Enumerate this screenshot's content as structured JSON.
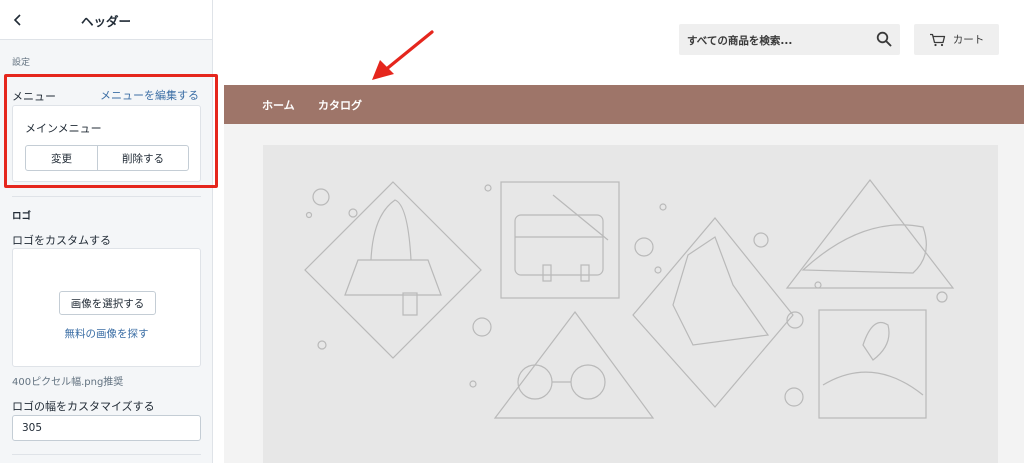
{
  "sidebar": {
    "title": "ヘッダー",
    "back_icon": "chevron-left-icon",
    "section_label": "設定",
    "menu": {
      "label": "メニュー",
      "edit_link": "メニューを編集する",
      "selected_menu": "メインメニュー",
      "change_button": "変更",
      "remove_button": "削除する"
    },
    "logo": {
      "heading": "ロゴ",
      "customize_label": "ロゴをカスタムする",
      "select_image_button": "画像を選択する",
      "free_images_link": "無料の画像を探す",
      "hint": "400ピクセル幅.png推奨",
      "width_label": "ロゴの幅をカスタマイズする",
      "width_value": "305"
    }
  },
  "preview": {
    "search": {
      "placeholder": "すべての商品を検索...",
      "icon": "search-icon"
    },
    "cart": {
      "label": "カート",
      "icon": "cart-icon"
    },
    "nav": {
      "background_color": "#9e7569",
      "items": [
        {
          "label": "ホーム"
        },
        {
          "label": "カタログ"
        }
      ]
    }
  },
  "annotations": {
    "highlight_color": "#e5261d"
  }
}
